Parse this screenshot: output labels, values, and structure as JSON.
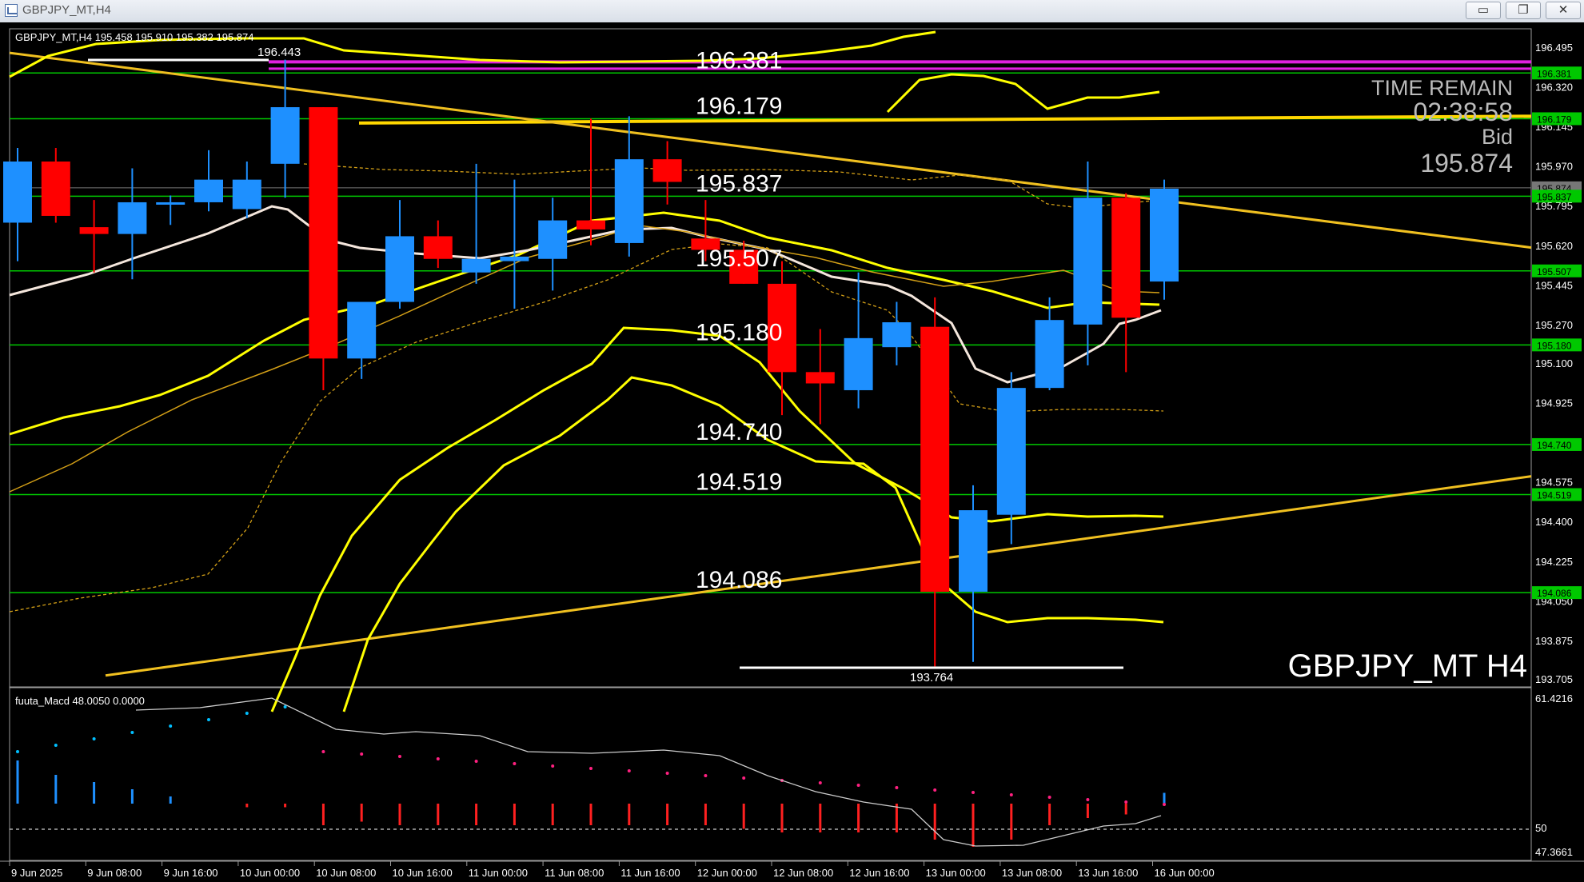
{
  "window": {
    "title": "GBPJPY_MT,H4",
    "minimize_icon": "minimize-icon",
    "maximize_icon": "maximize-icon",
    "close_icon": "close-icon",
    "minimize_glyph": "▭",
    "maximize_glyph": "❐",
    "close_glyph": "✕"
  },
  "main_chart": {
    "header": "GBPJPY_MT,H4  195.458 195.910 195.382 195.874",
    "symbol_label": "GBPJPY_MT H4",
    "time_remain_label": "TIME REMAIN",
    "time_remain_value": "02:38:58",
    "bid_label": "Bid",
    "bid_value": "195.874",
    "high_marker": "196.443",
    "low_marker": "193.764",
    "level_labels": [
      "196.381",
      "196.179",
      "195.837",
      "195.507",
      "195.180",
      "194.740",
      "194.519",
      "194.086"
    ],
    "colors": {
      "bull": "#1e90ff",
      "bear": "#ff0000",
      "level": "#00c800",
      "trend": "#ffd700",
      "bands": "#ffff00",
      "resistance": "#e020e0"
    }
  },
  "price_axis": {
    "ticks": [
      "196.495",
      "196.320",
      "196.145",
      "195.970",
      "195.795",
      "195.620",
      "195.445",
      "195.270",
      "195.100",
      "194.925",
      "194.750",
      "194.575",
      "194.400",
      "194.225",
      "194.050",
      "193.875",
      "193.705"
    ],
    "badges": [
      "196.381",
      "196.179",
      "195.874",
      "195.837",
      "195.507",
      "195.180",
      "194.740",
      "194.519",
      "194.086"
    ]
  },
  "indicator": {
    "label": "fuuta_Macd 48.0050  0.0000",
    "ticks": [
      "61.4216",
      "50",
      "47.3661"
    ]
  },
  "time_axis": {
    "labels": [
      "9 Jun 2025",
      "9 Jun 08:00",
      "9 Jun 16:00",
      "10 Jun 00:00",
      "10 Jun 08:00",
      "10 Jun 16:00",
      "11 Jun 00:00",
      "11 Jun 08:00",
      "11 Jun 16:00",
      "12 Jun 00:00",
      "12 Jun 08:00",
      "12 Jun 16:00",
      "13 Jun 00:00",
      "13 Jun 08:00",
      "13 Jun 16:00",
      "16 Jun 00:00"
    ]
  },
  "chart_data": {
    "type": "candlestick",
    "title": "GBPJPY_MT,H4",
    "candles": [
      {
        "o": 195.72,
        "h": 196.05,
        "l": 195.55,
        "c": 195.99
      },
      {
        "o": 195.99,
        "h": 196.05,
        "l": 195.72,
        "c": 195.75
      },
      {
        "o": 195.7,
        "h": 195.82,
        "l": 195.5,
        "c": 195.67
      },
      {
        "o": 195.67,
        "h": 195.96,
        "l": 195.47,
        "c": 195.81
      },
      {
        "o": 195.8,
        "h": 195.84,
        "l": 195.71,
        "c": 195.81
      },
      {
        "o": 195.81,
        "h": 196.04,
        "l": 195.77,
        "c": 195.91
      },
      {
        "o": 195.78,
        "h": 195.99,
        "l": 195.74,
        "c": 195.91
      },
      {
        "o": 195.98,
        "h": 196.44,
        "l": 195.83,
        "c": 196.23
      },
      {
        "o": 196.23,
        "h": 196.23,
        "l": 194.98,
        "c": 195.12
      },
      {
        "o": 195.12,
        "h": 195.36,
        "l": 195.03,
        "c": 195.37
      },
      {
        "o": 195.37,
        "h": 195.82,
        "l": 195.34,
        "c": 195.66
      },
      {
        "o": 195.66,
        "h": 195.73,
        "l": 195.52,
        "c": 195.56
      },
      {
        "o": 195.5,
        "h": 195.98,
        "l": 195.45,
        "c": 195.56
      },
      {
        "o": 195.55,
        "h": 195.91,
        "l": 195.34,
        "c": 195.57
      },
      {
        "o": 195.56,
        "h": 195.83,
        "l": 195.42,
        "c": 195.73
      },
      {
        "o": 195.73,
        "h": 196.18,
        "l": 195.62,
        "c": 195.69
      },
      {
        "o": 195.63,
        "h": 196.19,
        "l": 195.57,
        "c": 196.0
      },
      {
        "o": 196.0,
        "h": 196.08,
        "l": 195.8,
        "c": 195.9
      },
      {
        "o": 195.65,
        "h": 195.82,
        "l": 195.55,
        "c": 195.6
      },
      {
        "o": 195.6,
        "h": 195.64,
        "l": 195.45,
        "c": 195.45
      },
      {
        "o": 195.45,
        "h": 195.55,
        "l": 194.87,
        "c": 195.06
      },
      {
        "o": 195.06,
        "h": 195.25,
        "l": 194.83,
        "c": 195.01
      },
      {
        "o": 194.98,
        "h": 195.5,
        "l": 194.9,
        "c": 195.21
      },
      {
        "o": 195.17,
        "h": 195.37,
        "l": 195.09,
        "c": 195.28
      },
      {
        "o": 195.26,
        "h": 195.39,
        "l": 193.76,
        "c": 194.09
      },
      {
        "o": 194.09,
        "h": 194.56,
        "l": 193.78,
        "c": 194.45
      },
      {
        "o": 194.43,
        "h": 195.06,
        "l": 194.3,
        "c": 194.99
      },
      {
        "o": 194.99,
        "h": 195.39,
        "l": 194.98,
        "c": 195.29
      },
      {
        "o": 195.27,
        "h": 195.99,
        "l": 195.09,
        "c": 195.83
      },
      {
        "o": 195.83,
        "h": 195.85,
        "l": 195.06,
        "c": 195.3
      },
      {
        "o": 195.46,
        "h": 195.91,
        "l": 195.38,
        "c": 195.87
      }
    ],
    "horizontal_levels": [
      196.381,
      196.179,
      195.837,
      195.507,
      195.18,
      194.74,
      194.519,
      194.086
    ],
    "ylim": [
      193.705,
      196.495
    ]
  }
}
